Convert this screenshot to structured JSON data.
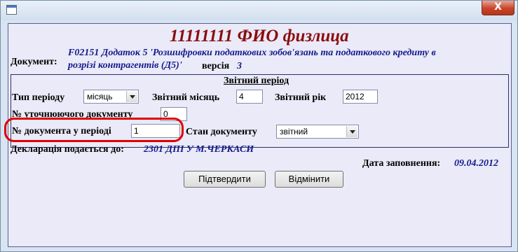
{
  "window": {
    "close_glyph": "X",
    "sys_icon": "window-icon"
  },
  "header": {
    "title": "11111111 ФИО физлица"
  },
  "document": {
    "label": "Документ:",
    "name_line1": "F02151 Додаток 5 'Розшифровки податкових зобов'язань та податкового кредиту в",
    "name_line2": "розрізі контрагентів (Д5)'",
    "version_label": "версія",
    "version_value": "3"
  },
  "period": {
    "legend": "Звітний період",
    "type_label": "Тип періоду",
    "type_value": "місяць",
    "month_label": "Звітний місяць",
    "month_value": "4",
    "year_label": "Звітний рік",
    "year_value": "2012",
    "clarify_label": "№ уточнюючого документу",
    "clarify_value": "0",
    "docnum_label": "№ документа у періоді",
    "docnum_value": "1",
    "state_label": "Стан документу",
    "state_value": "звітний"
  },
  "declaration": {
    "label": "Декларація подається до:",
    "value": "2301  ДПІ У М.ЧЕРКАСИ"
  },
  "fill_date": {
    "label": "Дата заповнення:",
    "value": "09.04.2012"
  },
  "buttons": {
    "confirm": "Підтвердити",
    "cancel": "Відмінити"
  },
  "colors": {
    "title": "#8b0d0d",
    "value_text": "#141a8a",
    "highlight": "#e00000"
  }
}
